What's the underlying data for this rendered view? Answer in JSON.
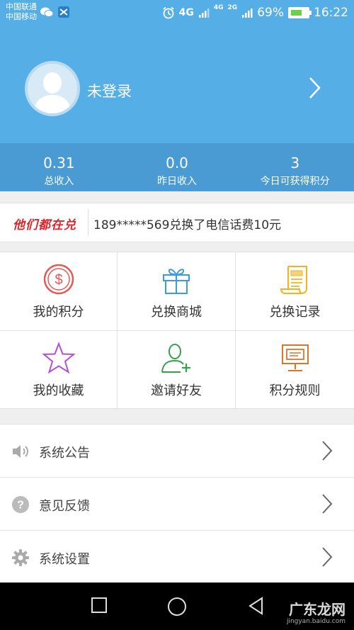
{
  "status_bar": {
    "carrier_1": "中国联通",
    "carrier_2": "中国移动",
    "network_4g": "4G",
    "network_4g_small": "4G",
    "network_2g_small": "2G",
    "battery_percent": "69%",
    "battery_level": 0.69,
    "time": "16:22",
    "app_icons": [
      "wechat-icon",
      "app-icon"
    ]
  },
  "profile": {
    "login_status": "未登录"
  },
  "stats": [
    {
      "value": "0.31",
      "label": "总收入"
    },
    {
      "value": "0.0",
      "label": "昨日收入"
    },
    {
      "value": "3",
      "label": "今日可获得积分"
    }
  ],
  "ticker": {
    "brand": "他们都在兑",
    "message": "189*****569兑换了电信话费10元"
  },
  "grid": [
    {
      "label": "我的积分",
      "icon": "dollar-coin-icon",
      "color": "#e05a56"
    },
    {
      "label": "兑换商城",
      "icon": "gift-box-icon",
      "color": "#3d9be0"
    },
    {
      "label": "兑换记录",
      "icon": "scroll-icon",
      "color": "#f0b323"
    },
    {
      "label": "我的收藏",
      "icon": "star-icon",
      "color": "#b44fd1"
    },
    {
      "label": "邀请好友",
      "icon": "add-user-icon",
      "color": "#37a04d"
    },
    {
      "label": "积分规则",
      "icon": "presentation-board-icon",
      "color": "#d9762b"
    }
  ],
  "list": [
    {
      "label": "系统公告",
      "icon": "speaker-icon"
    },
    {
      "label": "意见反馈",
      "icon": "question-icon"
    },
    {
      "label": "系统设置",
      "icon": "gear-icon"
    }
  ],
  "nav": {
    "buttons": [
      "recent-apps-icon",
      "home-icon",
      "back-icon"
    ],
    "watermark": "广东龙网",
    "watermark_sub": "jingyan.baidu.com"
  },
  "colors": {
    "header_blue": "#56aee6",
    "stats_blue": "#4a9bd4",
    "ticker_red": "#d9252b"
  }
}
